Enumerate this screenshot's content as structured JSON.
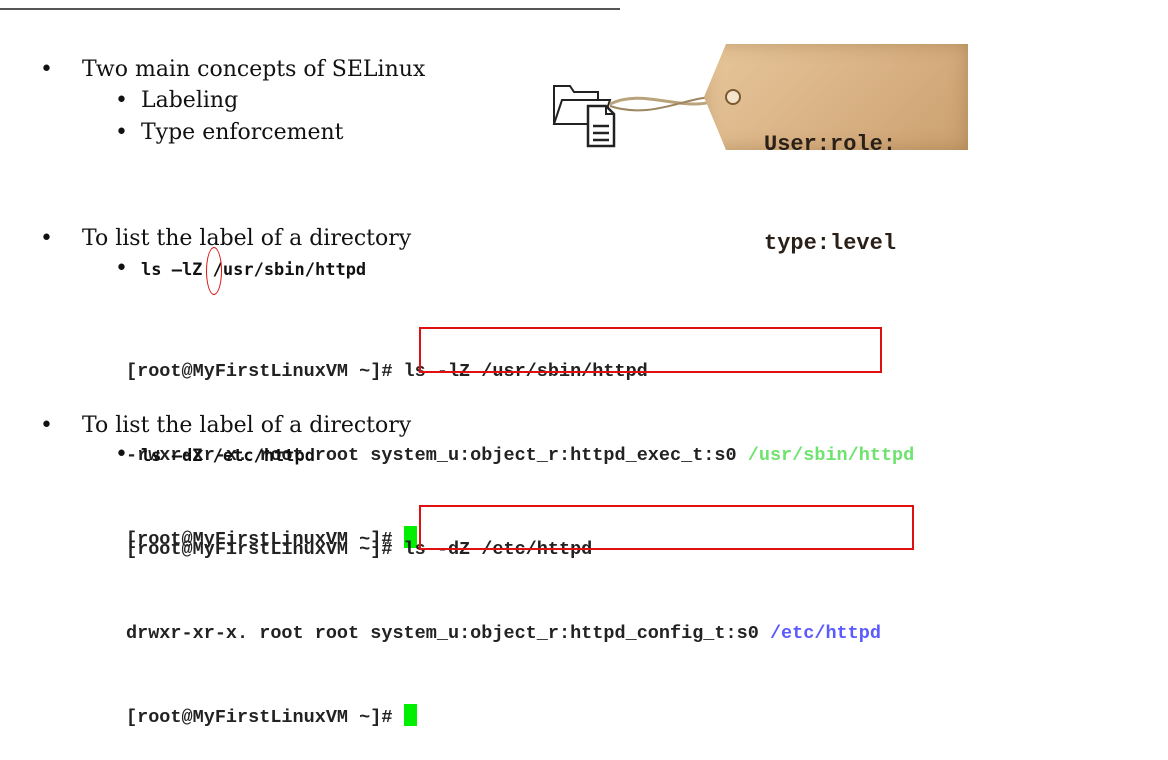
{
  "section1": {
    "bullet": "Two main concepts of SELinux",
    "subs": [
      "Labeling",
      "Type enforcement"
    ]
  },
  "tag": {
    "line1": "User:role:",
    "line2": "type:level"
  },
  "section2": {
    "bullet": "To list the label of a directory",
    "command": "ls –lZ /usr/sbin/httpd",
    "terminal": {
      "line1": "[root@MyFirstLinuxVM ~]# ls -lZ /usr/sbin/httpd",
      "line2_prefix": "-rwxr-xr-x. root root ",
      "line2_label": "system_u:object_r:httpd_exec_t:s0",
      "line2_path": "/usr/sbin/httpd",
      "line3": "[root@MyFirstLinuxVM ~]# "
    }
  },
  "section3": {
    "bullet": "To list the label of a directory",
    "command": "ls –dZ /etc/httpd",
    "terminal": {
      "line1": "[root@MyFirstLinuxVM ~]# ls -dZ /etc/httpd",
      "line2_prefix": "drwxr-xr-x. root root ",
      "line2_label": "system_u:object_r:httpd_config_t:s0",
      "line2_path": "/etc/httpd",
      "line3": "[root@MyFirstLinuxVM ~]# "
    }
  },
  "colors": {
    "highlight": "#e01010",
    "cursor": "#00ee00",
    "path_green": "#6ee36e",
    "path_blue": "#5a5aff"
  },
  "icons": [
    "folder-document-icon",
    "tag-string-icon"
  ]
}
